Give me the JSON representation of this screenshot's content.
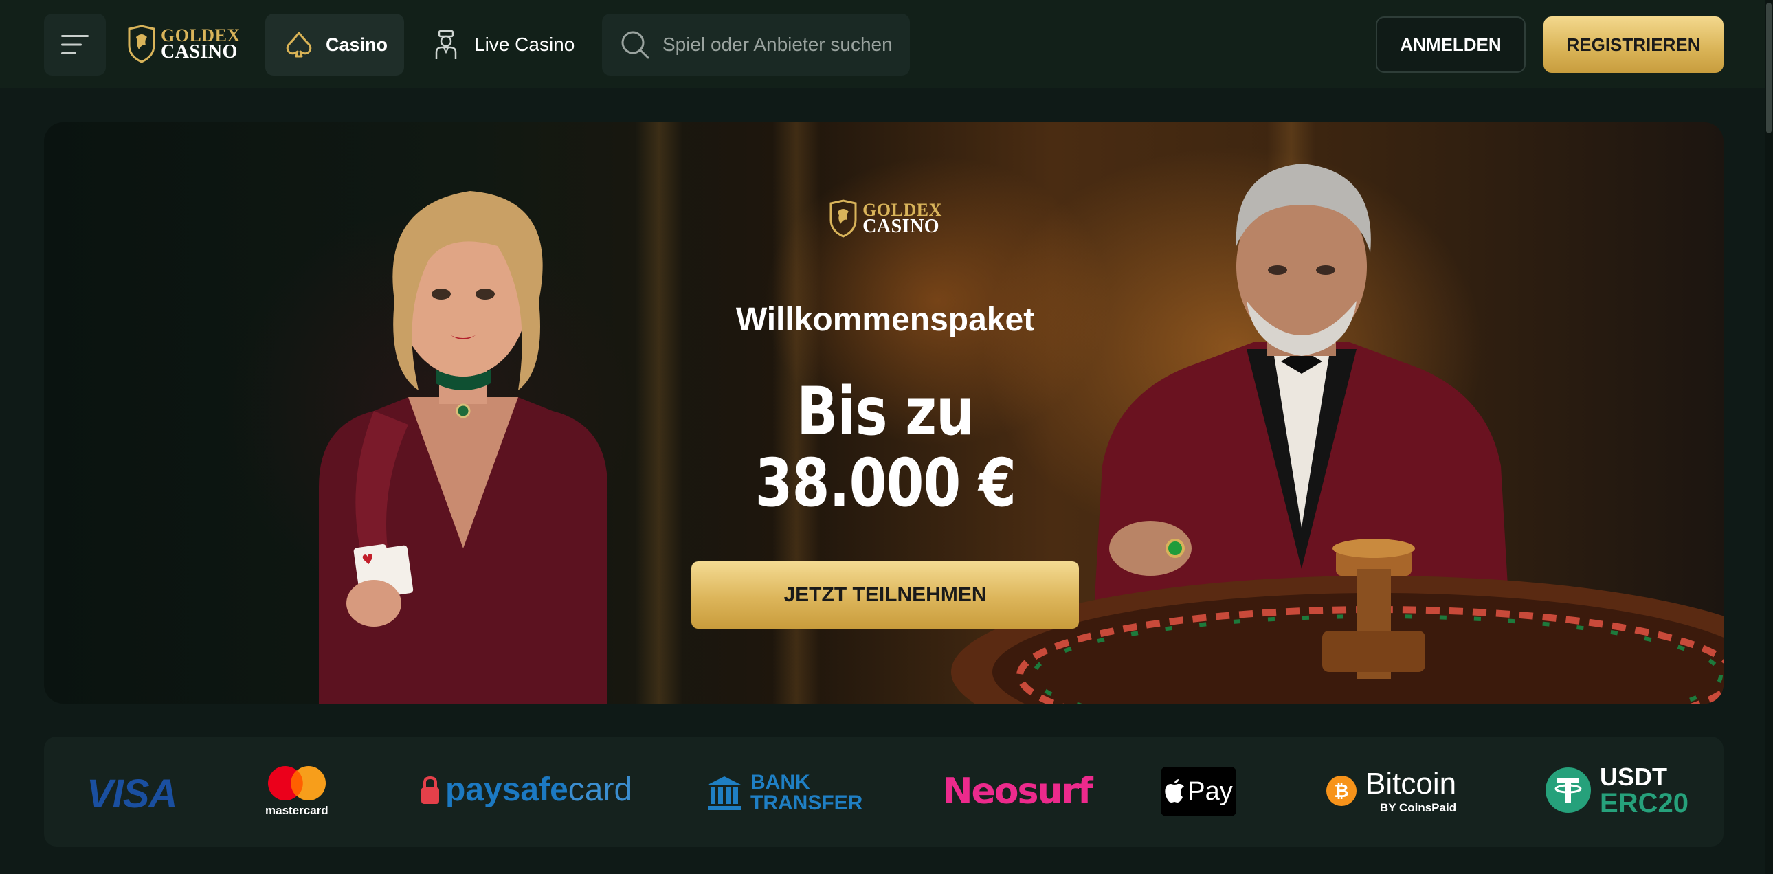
{
  "header": {
    "menu_icon": "hamburger-menu-icon",
    "logo": {
      "line1": "GOLDEX",
      "line2": "CASINO"
    },
    "nav": [
      {
        "label": "Casino",
        "icon": "spade-icon",
        "active": true
      },
      {
        "label": "Live Casino",
        "icon": "dealer-icon",
        "active": false
      }
    ],
    "search": {
      "placeholder": "Spiel oder Anbieter suchen",
      "icon": "search-icon"
    },
    "login_label": "ANMELDEN",
    "register_label": "REGISTRIEREN"
  },
  "hero": {
    "logo": {
      "line1": "GOLDEX",
      "line2": "CASINO"
    },
    "title": "Willkommenspaket",
    "amount_line1": "Bis zu",
    "amount_line2": "38.000 €",
    "cta_label": "JETZT TEILNEHMEN"
  },
  "payments": {
    "visa": "VISA",
    "mastercard": "mastercard",
    "paysafe": {
      "part1": "paysafe",
      "part2": "card"
    },
    "bank": {
      "line1": "BANK",
      "line2": "TRANSFER"
    },
    "neosurf": "Neosurf",
    "apple_pay": "Pay",
    "bitcoin": {
      "name": "Bitcoin",
      "by": "BY CoinsPaid"
    },
    "usdt": {
      "line1": "USDT",
      "line2": "ERC20"
    }
  },
  "colors": {
    "background": "#0f1a17",
    "header": "#122019",
    "gold": "#d9b356",
    "visa_blue": "#1a4fa0",
    "neosurf_pink": "#ec2a8c",
    "tether_green": "#26a17b",
    "bitcoin_orange": "#f7931a"
  }
}
